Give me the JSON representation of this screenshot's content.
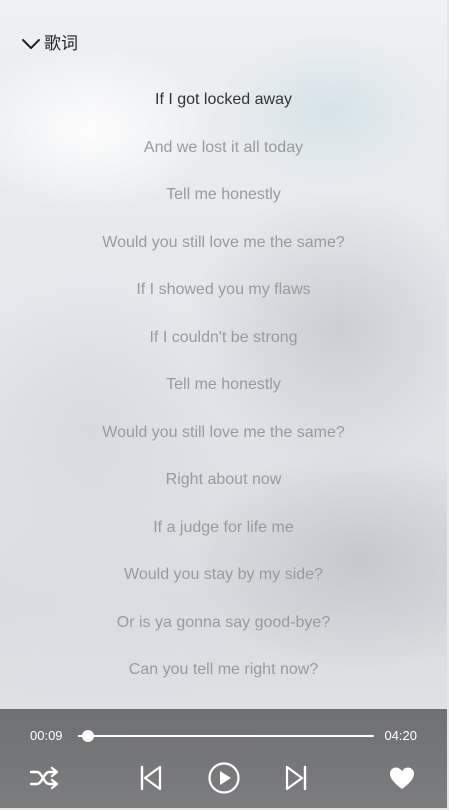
{
  "header": {
    "title": "歌词",
    "back_icon": "chevron-down-icon"
  },
  "lyrics": {
    "active_index": 0,
    "lines": [
      "If I got locked away",
      "And we lost it all today",
      "Tell me honestly",
      "Would you still love me the same?",
      "If I showed you my flaws",
      "If I couldn't be strong",
      "Tell me honestly",
      "Would you still love me the same?",
      "Right about now",
      "If a judge for life me",
      "Would you stay by my side?",
      "Or is ya gonna say good-bye?",
      "Can you tell me right now?"
    ]
  },
  "player": {
    "current_time": "00:09",
    "total_time": "04:20",
    "progress_fraction": 0.035,
    "controls": {
      "shuffle_icon": "shuffle-icon",
      "previous_icon": "skip-previous-icon",
      "play_icon": "play-icon",
      "next_icon": "skip-next-icon",
      "favorite_icon": "heart-icon"
    }
  },
  "colors": {
    "active_lyric": "#333333",
    "inactive_lyric": "#9a9a9a",
    "player_bar": "#6b6c6e",
    "player_foreground": "#ffffff"
  }
}
